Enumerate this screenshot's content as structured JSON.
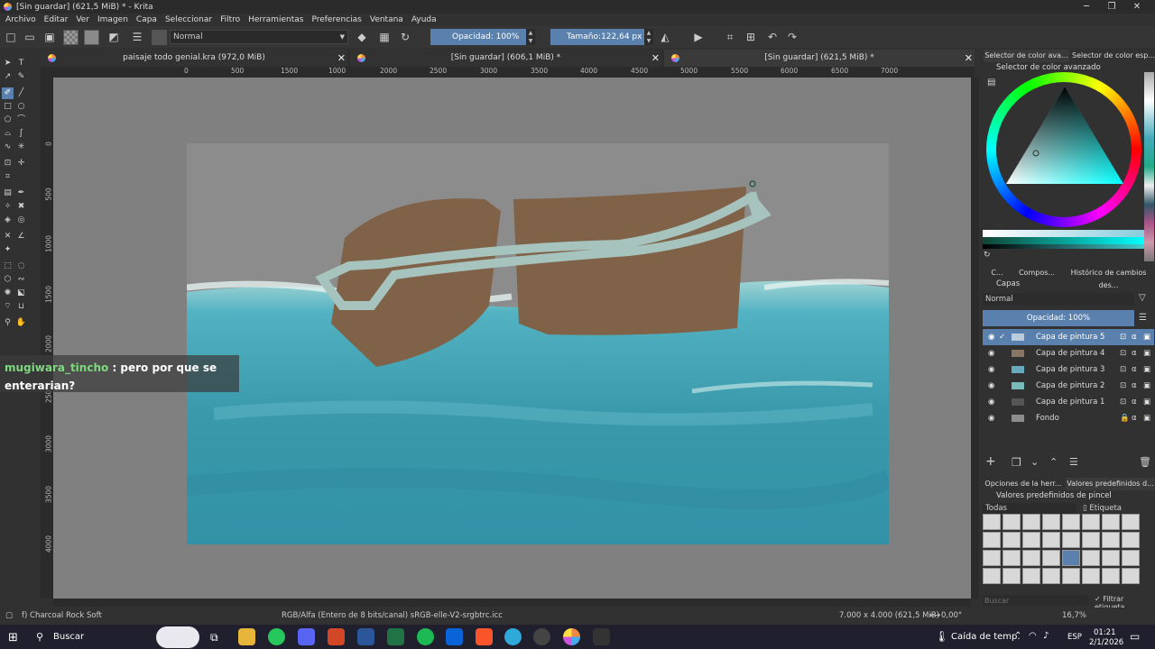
{
  "window": {
    "title": "[Sin guardar]  (621,5 MiB) * - Krita",
    "minimize": "─",
    "restore": "❐",
    "close": "✕"
  },
  "menu": [
    "Archivo",
    "Editar",
    "Ver",
    "Imagen",
    "Capa",
    "Seleccionar",
    "Filtro",
    "Herramientas",
    "Preferencias",
    "Ventana",
    "Ayuda"
  ],
  "toolbar": {
    "blend_mode": "Normal",
    "opacity": "Opacidad: 100%",
    "size_label": "Tamaño:",
    "size_value": "122,64 px"
  },
  "tabs": [
    {
      "label": "paisaje todo genial.kra (972,0 MiB)"
    },
    {
      "label": "[Sin guardar]  (606,1 MiB) *"
    },
    {
      "label": "[Sin guardar]  (621,5 MiB) *"
    }
  ],
  "ruler_top": [
    "0",
    "500",
    "1000",
    "1500",
    "2000",
    "2500",
    "3000",
    "3500",
    "4000",
    "4500",
    "5000",
    "5500",
    "6000",
    "6500",
    "7000"
  ],
  "ruler_left": [
    "0",
    "500",
    "1000",
    "1500",
    "2000",
    "2500",
    "3000",
    "3500",
    "4000"
  ],
  "chat": {
    "user": "mugiwara_tincho",
    "message": ": pero por que se enterarian?"
  },
  "panel": {
    "tabs": [
      "Selector de color ava...",
      "Selector de color esp..."
    ],
    "color_title": "Selector de color avanzado",
    "layer_tabs": [
      "C...",
      "Compos...",
      "Histórico de cambios des..."
    ],
    "layers_title": "Capas",
    "layer_blend": "Normal",
    "layer_opacity": "Opacidad:  100%",
    "layers": [
      {
        "name": "Capa de pintura 5",
        "selected": true
      },
      {
        "name": "Capa de pintura 4",
        "selected": false
      },
      {
        "name": "Capa de pintura 3",
        "selected": false
      },
      {
        "name": "Capa de pintura 2",
        "selected": false
      },
      {
        "name": "Capa de pintura 1",
        "selected": false
      },
      {
        "name": "Fondo",
        "selected": false
      }
    ],
    "tool_tabs": [
      "Opciones de la herr...",
      "Valores predefinidos d..."
    ],
    "presets_title": "Valores predefinidos de pincel",
    "preset_filter": "Todas",
    "preset_tag": "Etiqueta",
    "search_placeholder": "Buscar",
    "filter_tag": "Filtrar etiqueta"
  },
  "status": {
    "brush": "f) Charcoal Rock Soft",
    "color_model": "RGB/Alfa (Entero de 8 bits/canal)  sRGB-elle-V2-srgbtrc.icc",
    "dimensions": "7.000 x 4.000 (621,5 MiB)",
    "rotation": "0,00°",
    "zoom": "16,7%"
  },
  "taskbar": {
    "search": "Buscar",
    "weather": "Caída de temp.",
    "lang": "ESP",
    "time": "01:21",
    "date": "2/1/2026"
  },
  "colors": {
    "accent": "#5a80ad",
    "water": "#3e9aac",
    "glasses": "#7f6248",
    "frame": "#a6c4bd"
  }
}
